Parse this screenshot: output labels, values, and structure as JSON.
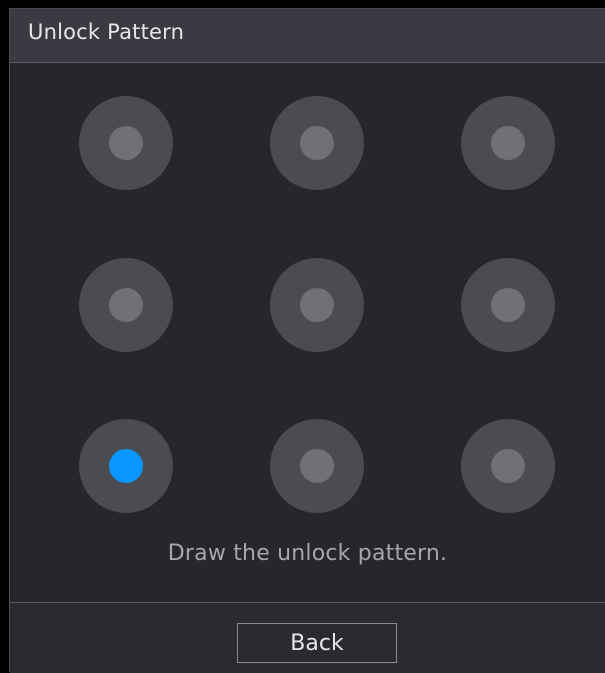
{
  "dialog": {
    "title": "Unlock Pattern",
    "hint": "Draw the unlock pattern.",
    "back_label": "Back"
  },
  "pattern": {
    "rows": 3,
    "cols": 3,
    "active_dots": [
      7
    ],
    "colors": {
      "active": "#0a96ff",
      "inactive_inner": "#707077",
      "outer": "#4b4b52"
    }
  }
}
